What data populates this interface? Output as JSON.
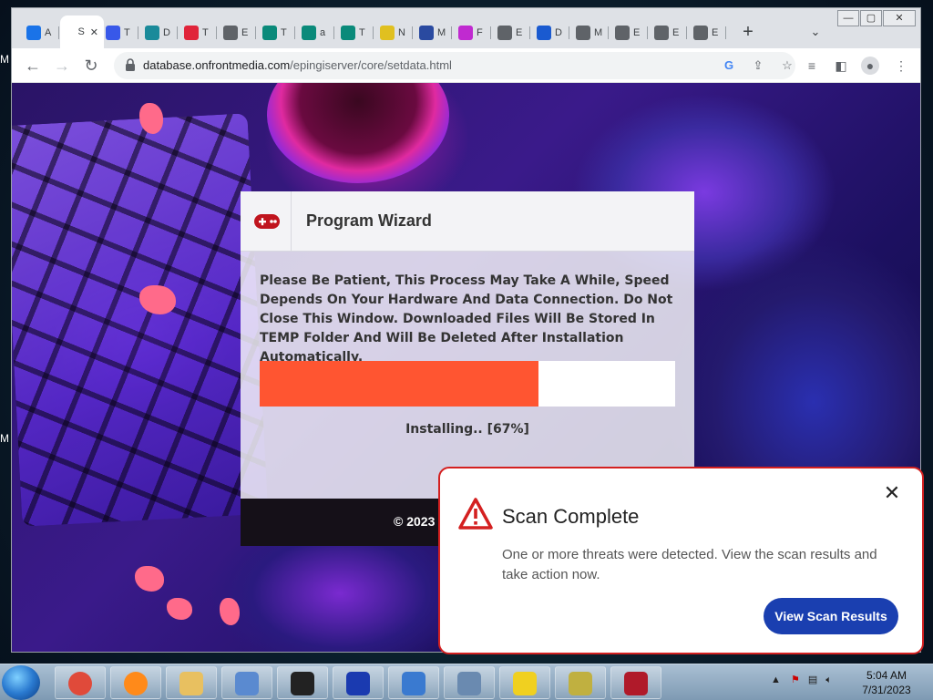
{
  "browser": {
    "tabs": [
      {
        "letter": "A",
        "icon": "loading-icon",
        "color": "#1a73e8"
      },
      {
        "letter": "S",
        "icon": "tab-icon",
        "color": "#ffffff",
        "active": true
      },
      {
        "letter": "T",
        "icon": "wordpress-icon",
        "color": "#3858e9"
      },
      {
        "letter": "D",
        "icon": "cloud-lock-icon",
        "color": "#1a8a9a"
      },
      {
        "letter": "T",
        "icon": "opera-icon",
        "color": "#e0243a"
      },
      {
        "letter": "E",
        "icon": "globe-icon",
        "color": "#5f6368"
      },
      {
        "letter": "T",
        "icon": "play-icon",
        "color": "#0a8a7a"
      },
      {
        "letter": "a",
        "icon": "play-icon",
        "color": "#0a8a7a"
      },
      {
        "letter": "T",
        "icon": "play-icon",
        "color": "#0a8a7a"
      },
      {
        "letter": "N",
        "icon": "check-icon",
        "color": "#e0c020"
      },
      {
        "letter": "M",
        "icon": "globe-icon",
        "color": "#2a4aa0"
      },
      {
        "letter": "F",
        "icon": "ai-icon",
        "color": "#c02ad0"
      },
      {
        "letter": "E",
        "icon": "globe-icon",
        "color": "#5f6368"
      },
      {
        "letter": "D",
        "icon": "s-icon",
        "color": "#1a5ad0"
      },
      {
        "letter": "M",
        "icon": "chrome-icon",
        "color": "#5f6368"
      },
      {
        "letter": "E",
        "icon": "globe-icon",
        "color": "#5f6368"
      },
      {
        "letter": "E",
        "icon": "globe-icon",
        "color": "#5f6368"
      },
      {
        "letter": "E",
        "icon": "globe-icon",
        "color": "#5f6368"
      }
    ],
    "new_tab": "+",
    "tab_menu": "⌄",
    "url_host": "database.onfrontmedia.com",
    "url_path": "/epingiserver/core/setdata.html"
  },
  "wizard": {
    "title": "Program Wizard",
    "message": "Please Be Patient, This Process May Take A While, Speed Depends On Your Hardware And Data Connection. Do Not Close This Window. Downloaded Files Will Be Stored In TEMP Folder And Will Be Deleted After Installation Automatically.",
    "progress_percent": 67,
    "progress_label": "Installing.. [67%]",
    "footer": "© 2023",
    "progress_color": "#ff5531"
  },
  "scan_popup": {
    "title": "Scan Complete",
    "message": "One or more threats were detected. View the scan results and take action now.",
    "button_label": "View Scan Results",
    "close_label": "✕",
    "accent_color": "#d42020",
    "button_color": "#1a3fb0"
  },
  "taskbar": {
    "apps": [
      "chrome-icon",
      "firefox-icon",
      "folder-icon",
      "security-icon",
      "terminal-icon",
      "malwarebytes-icon",
      "shield-icon",
      "installer-icon",
      "puzzle-icon",
      "network-icon",
      "app-icon"
    ],
    "time": "5:04 AM",
    "date": "7/31/2023"
  }
}
